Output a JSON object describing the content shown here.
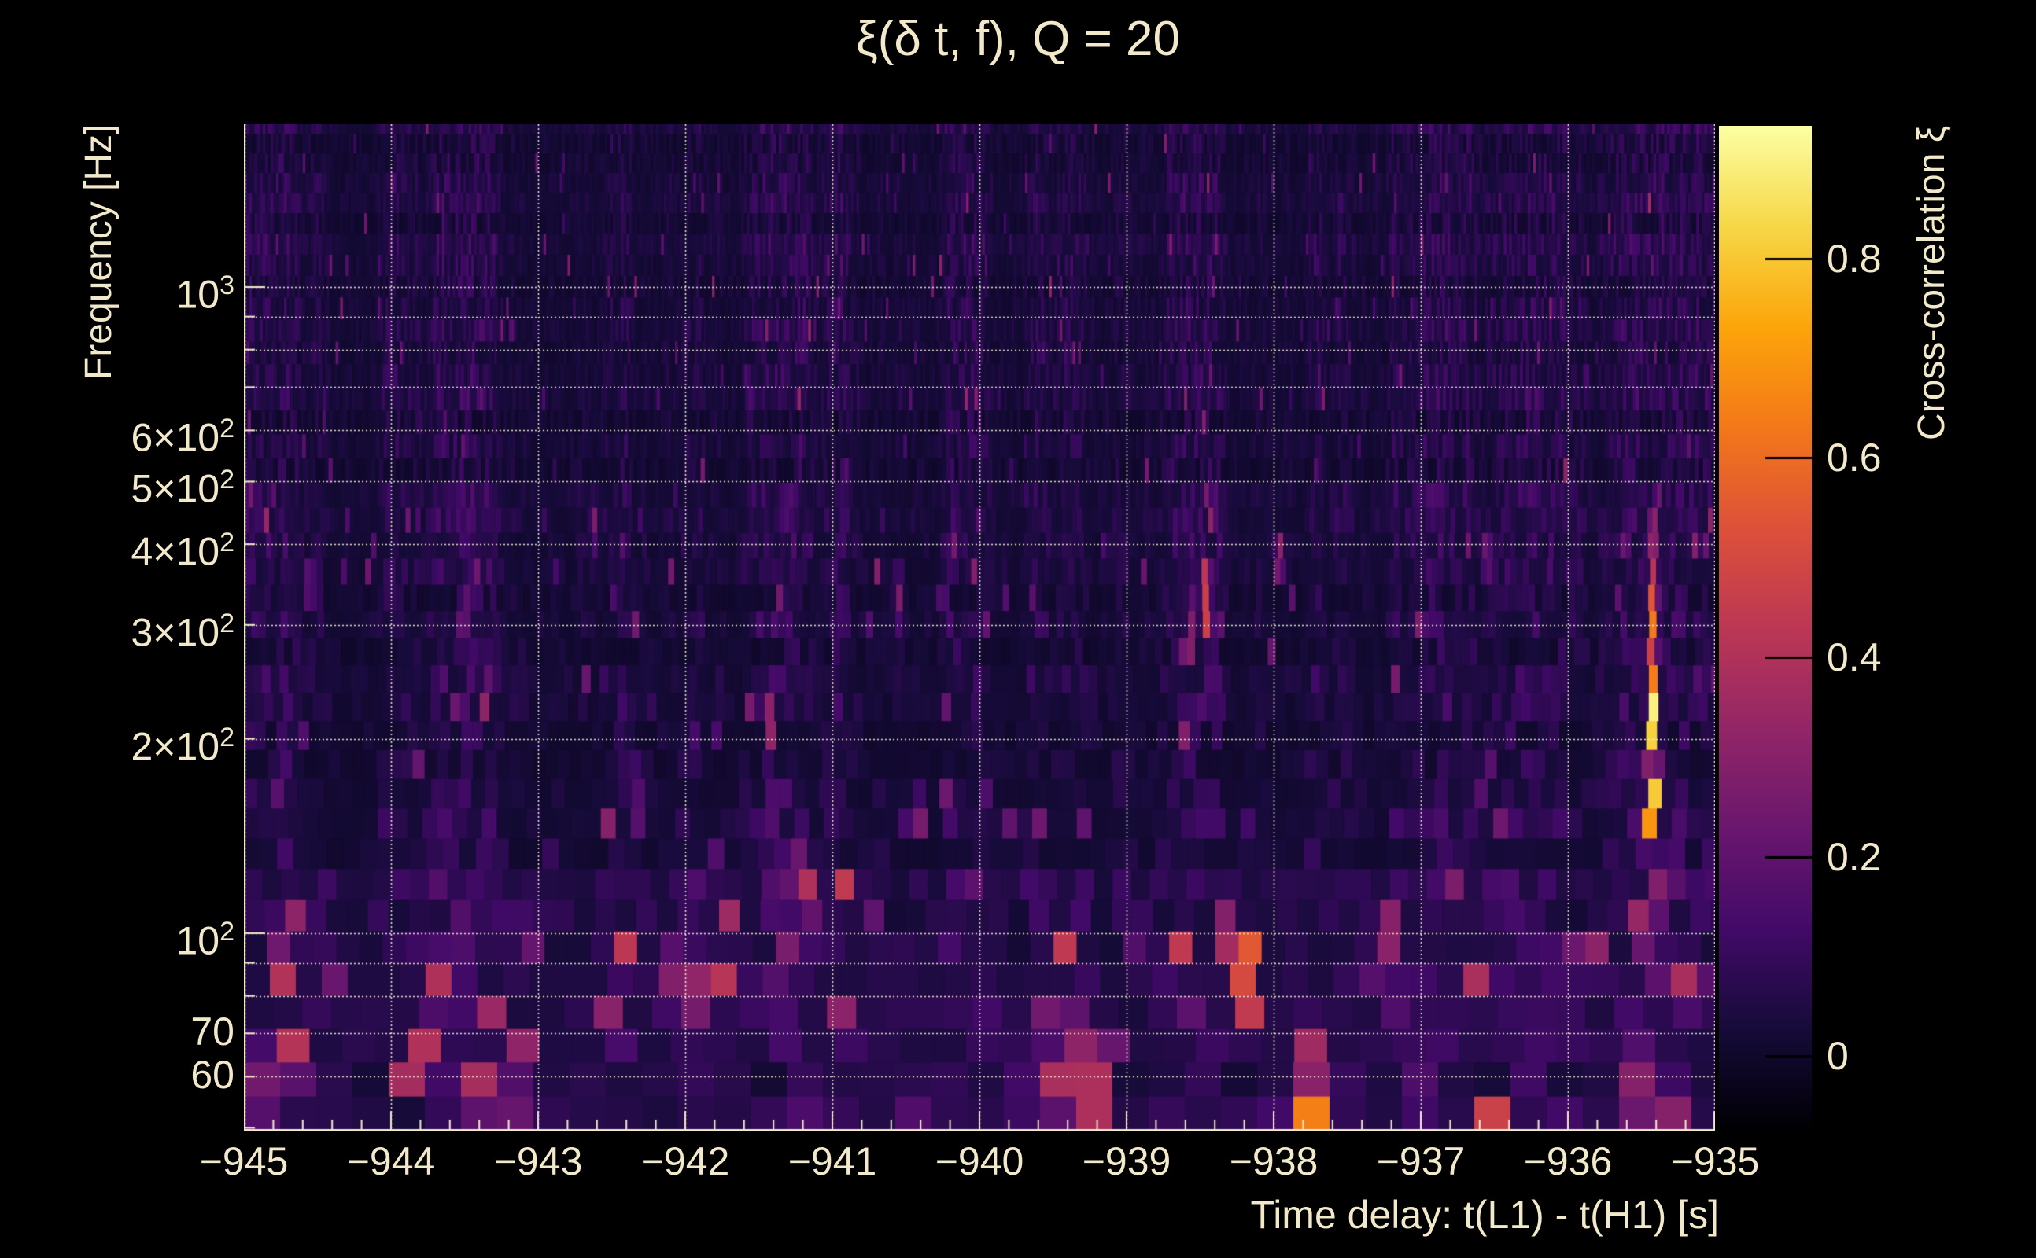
{
  "page": {
    "background": "#000000",
    "text_color": "#f2e9cb"
  },
  "chart_data": {
    "type": "heatmap",
    "title": "ξ(δ t, f), Q = 20",
    "xlabel": "Time delay: t(L1) - t(H1) [s]",
    "ylabel": "Frequency [Hz]",
    "colorbar_label": "Cross-correlation ξ",
    "x_range": [
      -945,
      -935
    ],
    "x_minor_tick_step": 0.2,
    "x_ticks": [
      {
        "t": -945,
        "label": "−945"
      },
      {
        "t": -944,
        "label": "−944"
      },
      {
        "t": -943,
        "label": "−943"
      },
      {
        "t": -942,
        "label": "−942"
      },
      {
        "t": -941,
        "label": "−941"
      },
      {
        "t": -940,
        "label": "−940"
      },
      {
        "t": -939,
        "label": "−939"
      },
      {
        "t": -938,
        "label": "−938"
      },
      {
        "t": -937,
        "label": "−937"
      },
      {
        "t": -936,
        "label": "−936"
      },
      {
        "t": -935,
        "label": "−935"
      }
    ],
    "y_scale": "log",
    "y_range_hz": [
      49.5,
      1786
    ],
    "y_ticks": [
      {
        "f": 1000,
        "mant": "10",
        "exp": "3"
      },
      {
        "f": 600,
        "mant": "6×10",
        "exp": "2"
      },
      {
        "f": 500,
        "mant": "5×10",
        "exp": "2"
      },
      {
        "f": 400,
        "mant": "4×10",
        "exp": "2"
      },
      {
        "f": 300,
        "mant": "3×10",
        "exp": "2"
      },
      {
        "f": 200,
        "mant": "2×10",
        "exp": "2"
      },
      {
        "f": 100,
        "mant": "10",
        "exp": "2"
      },
      {
        "f": 70,
        "mant": "70"
      },
      {
        "f": 60,
        "mant": "60"
      }
    ],
    "y_gridlines_hz": [
      60,
      70,
      80,
      90,
      100,
      200,
      300,
      400,
      500,
      600,
      700,
      800,
      900,
      1000
    ],
    "y_minor_ticks_hz": [
      50,
      60,
      70,
      80,
      90,
      200,
      300,
      400,
      500,
      600,
      700,
      800,
      900
    ],
    "grid": {
      "style": "dotted",
      "color": "#f5eed6"
    },
    "colorbar": {
      "range": [
        -0.074,
        0.933
      ],
      "colormap": "inferno",
      "ticks": [
        {
          "v": 0.8,
          "label": "0.8"
        },
        {
          "v": 0.6,
          "label": "0.6"
        },
        {
          "v": 0.4,
          "label": "0.4"
        },
        {
          "v": 0.2,
          "label": "0.2"
        },
        {
          "v": 0.0,
          "label": "0"
        }
      ]
    },
    "features": [
      {
        "t": -935.42,
        "f_lo": 330,
        "f_hi": 430,
        "xi": 0.4,
        "dt": 0.022
      },
      {
        "t": -935.42,
        "f_lo": 240,
        "f_hi": 330,
        "xi": 0.62,
        "dt": 0.022
      },
      {
        "t": -935.42,
        "f_lo": 150,
        "f_hi": 240,
        "xi": 0.88,
        "dt": 0.025
      },
      {
        "t": -935.43,
        "f_lo": 95,
        "f_hi": 150,
        "xi": 0.8,
        "dt": 0.028
      },
      {
        "t": -935.45,
        "f_lo": 75,
        "f_hi": 95,
        "xi": 0.45,
        "dt": 0.03
      },
      {
        "t": -935.47,
        "f_lo": 50,
        "f_hi": 64,
        "xi": 0.5,
        "dt": 0.045
      },
      {
        "t": -935.55,
        "f_lo": 55,
        "f_hi": 65,
        "xi": 0.3,
        "dt": 0.05
      },
      {
        "t": -944.71,
        "f_lo": 57,
        "f_hi": 68,
        "xi": 0.58,
        "dt": 0.05
      },
      {
        "t": -944.83,
        "f_lo": 54,
        "f_hi": 61,
        "xi": 0.35,
        "dt": 0.05
      },
      {
        "t": -944.6,
        "f_lo": 68,
        "f_hi": 80,
        "xi": 0.25,
        "dt": 0.05
      },
      {
        "t": -944.55,
        "f_lo": 330,
        "f_hi": 362,
        "xi": 0.24,
        "dt": 0.02
      },
      {
        "t": -943.77,
        "f_lo": 67,
        "f_hi": 92,
        "xi": 0.38,
        "dt": 0.04
      },
      {
        "t": -943.64,
        "f_lo": 75,
        "f_hi": 85,
        "xi": 0.58,
        "dt": 0.04
      },
      {
        "t": -943.5,
        "f_lo": 298,
        "f_hi": 330,
        "xi": 0.24,
        "dt": 0.02
      },
      {
        "t": -943.43,
        "f_lo": 56,
        "f_hi": 80,
        "xi": 0.42,
        "dt": 0.05
      },
      {
        "t": -943.26,
        "f_lo": 49,
        "f_hi": 58,
        "xi": 0.62,
        "dt": 0.07
      },
      {
        "t": -943.1,
        "f_lo": 60,
        "f_hi": 70,
        "xi": 0.3,
        "dt": 0.05
      },
      {
        "t": -942.62,
        "f_lo": 415,
        "f_hi": 450,
        "xi": 0.26,
        "dt": 0.018
      },
      {
        "t": -942.35,
        "f_lo": 148,
        "f_hi": 166,
        "xi": 0.25,
        "dt": 0.03
      },
      {
        "t": -942.02,
        "f_lo": 86,
        "f_hi": 100,
        "xi": 0.55,
        "dt": 0.045
      },
      {
        "t": -941.9,
        "f_lo": 76,
        "f_hi": 86,
        "xi": 0.32,
        "dt": 0.04
      },
      {
        "t": -941.42,
        "f_lo": 198,
        "f_hi": 232,
        "xi": 0.3,
        "dt": 0.022
      },
      {
        "t": -941.2,
        "f_lo": 100,
        "f_hi": 128,
        "xi": 0.48,
        "dt": 0.045
      },
      {
        "t": -941.1,
        "f_lo": 50,
        "f_hi": 58,
        "xi": 0.32,
        "dt": 0.06
      },
      {
        "t": -940.75,
        "f_lo": 95,
        "f_hi": 110,
        "xi": 0.25,
        "dt": 0.04
      },
      {
        "t": -940.55,
        "f_lo": 315,
        "f_hi": 350,
        "xi": 0.26,
        "dt": 0.02
      },
      {
        "t": -939.79,
        "f_lo": 53,
        "f_hi": 62,
        "xi": 0.36,
        "dt": 0.05
      },
      {
        "t": -939.61,
        "f_lo": 63,
        "f_hi": 79,
        "xi": 0.55,
        "dt": 0.045
      },
      {
        "t": -939.45,
        "f_lo": 55,
        "f_hi": 66,
        "xi": 0.38,
        "dt": 0.05
      },
      {
        "t": -939.3,
        "f_lo": 63,
        "f_hi": 76,
        "xi": 0.3,
        "dt": 0.05
      },
      {
        "t": -939.15,
        "f_lo": 49,
        "f_hi": 63,
        "xi": 0.72,
        "dt": 0.06
      },
      {
        "t": -938.6,
        "f_lo": 188,
        "f_hi": 212,
        "xi": 0.28,
        "dt": 0.025
      },
      {
        "t": -938.56,
        "f_lo": 268,
        "f_hi": 322,
        "xi": 0.26,
        "dt": 0.022
      },
      {
        "t": -938.46,
        "f_lo": 300,
        "f_hi": 368,
        "xi": 0.45,
        "dt": 0.022
      },
      {
        "t": -938.3,
        "f_lo": 94,
        "f_hi": 106,
        "xi": 0.38,
        "dt": 0.04
      },
      {
        "t": -938.18,
        "f_lo": 77,
        "f_hi": 95,
        "xi": 0.6,
        "dt": 0.045
      },
      {
        "t": -937.96,
        "f_lo": 362,
        "f_hi": 400,
        "xi": 0.3,
        "dt": 0.02
      },
      {
        "t": -937.77,
        "f_lo": 49,
        "f_hi": 57,
        "xi": 0.65,
        "dt": 0.1
      },
      {
        "t": -937.2,
        "f_lo": 88,
        "f_hi": 106,
        "xi": 0.3,
        "dt": 0.05
      },
      {
        "t": -936.62,
        "f_lo": 150,
        "f_hi": 170,
        "xi": 0.24,
        "dt": 0.03
      },
      {
        "t": -936.55,
        "f_lo": 368,
        "f_hi": 400,
        "xi": 0.26,
        "dt": 0.02
      },
      {
        "t": -936.45,
        "f_lo": 48,
        "f_hi": 55,
        "xi": 0.62,
        "dt": 0.08
      },
      {
        "t": -936.0,
        "f_lo": 85,
        "f_hi": 97,
        "xi": 0.42,
        "dt": 0.035
      }
    ],
    "colormap_stops": [
      "#000004",
      "#160b39",
      "#420a68",
      "#6a176e",
      "#932667",
      "#bc3754",
      "#dd513a",
      "#f37819",
      "#fca50a",
      "#f6d746",
      "#fcffa4"
    ]
  }
}
